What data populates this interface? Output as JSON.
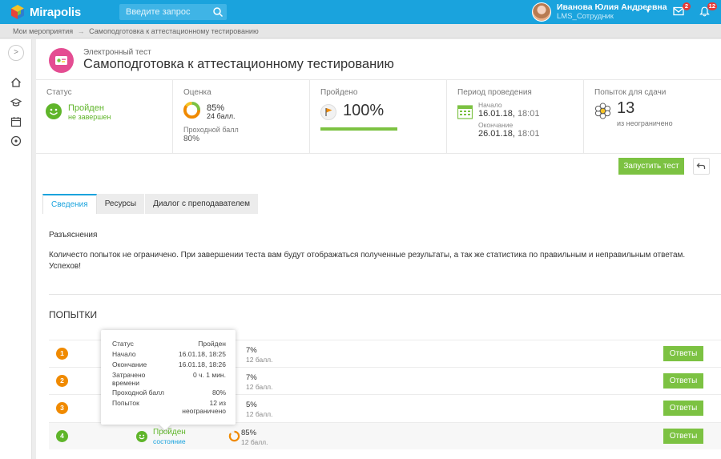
{
  "header": {
    "logo_text": "Mirapolis",
    "search_placeholder": "Введите запрос",
    "user_name": "Иванова Юлия Андреевна",
    "user_role": "LMS_Сотрудник",
    "messages_badge": "2",
    "notifications_badge": "12"
  },
  "breadcrumb": {
    "items": [
      "Мои мероприятия",
      "Самоподготовка к аттестационному тестированию"
    ],
    "separator": "→"
  },
  "page": {
    "subtitle": "Электронный тест",
    "title": "Самоподготовка к аттестационному тестированию"
  },
  "stats": {
    "status": {
      "label": "Статус",
      "value": "Пройден",
      "sub": "не завершен"
    },
    "score": {
      "label": "Оценка",
      "percent": "85%",
      "points": "24 балл.",
      "fraction": 0.85,
      "pass_label": "Проходной балл",
      "pass_value": "80%"
    },
    "done": {
      "label": "Пройдено",
      "percent": "100%",
      "fraction": 1.0
    },
    "period": {
      "label": "Период проведения",
      "start_label": "Начало",
      "start_date": "16.01.18,",
      "start_time": "18:01",
      "end_label": "Окончание",
      "end_date": "26.01.18,",
      "end_time": "18:01"
    },
    "tries": {
      "label": "Попыток для сдачи",
      "value": "13",
      "sub": "из неограничено"
    }
  },
  "actions": {
    "start_label": "Запустить тест"
  },
  "tabs": [
    {
      "label": "Сведения",
      "active": true
    },
    {
      "label": "Ресурсы",
      "active": false
    },
    {
      "label": "Диалог с преподавателем",
      "active": false
    }
  ],
  "details": {
    "heading": "Разъяснения",
    "line1": "Количесто попыток не ограничено. При завершении теста вам будут отображаться полученные результаты, а так же статистика по правильным и неправильным ответам.",
    "line2": "Успехов!"
  },
  "attempts": {
    "title": "ПОПЫТКИ",
    "answers_label": "Ответы",
    "rows": [
      {
        "num": "1",
        "color": "#f08a00",
        "pct": "7%",
        "pts": "12 балл."
      },
      {
        "num": "2",
        "color": "#f08a00",
        "pct": "7%",
        "pts": "12 балл."
      },
      {
        "num": "3",
        "color": "#f08a00",
        "pct": "5%",
        "pts": "12 балл."
      },
      {
        "num": "4",
        "color": "#5fb52a",
        "status": "Пройден",
        "state": "состояние",
        "pct": "85%",
        "pts": "12 балл.",
        "fraction": 0.85
      }
    ]
  },
  "tooltip": {
    "rows": [
      {
        "k": "Статус",
        "v": "Пройден"
      },
      {
        "k": "Начало",
        "v": "16.01.18, 18:25"
      },
      {
        "k": "Окончание",
        "v": "16.01.18, 18:26"
      },
      {
        "k": "Затрачено времени",
        "v": "0 ч. 1 мин."
      },
      {
        "k": "Проходной балл",
        "v": "80%"
      },
      {
        "k": "Попыток",
        "v": "12 из неограничено"
      }
    ]
  },
  "colors": {
    "accent": "#1aa3dd",
    "green": "#7cc242",
    "status_green": "#5fb52a",
    "orange": "#f08a00"
  }
}
